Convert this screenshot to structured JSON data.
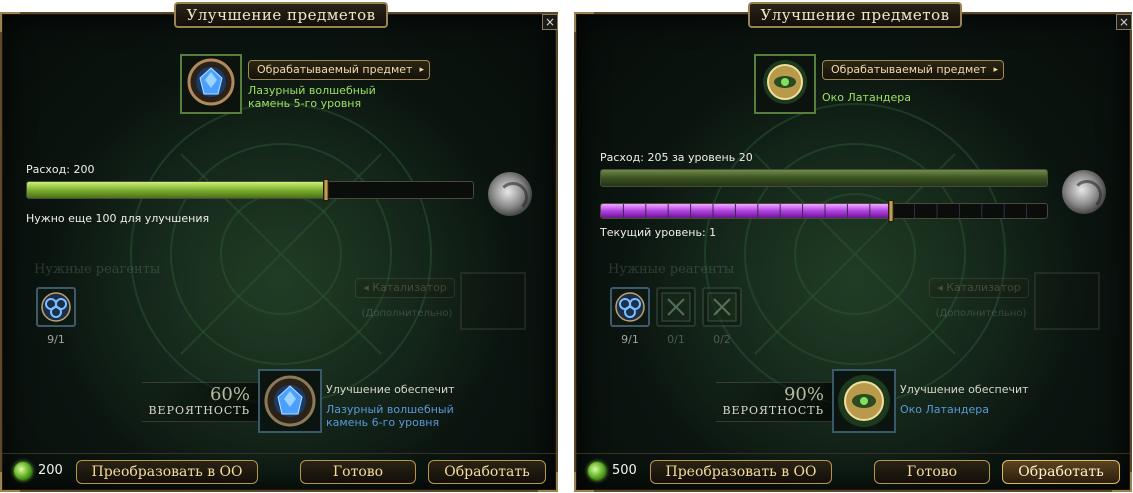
{
  "panels": [
    {
      "title": "Улучшение предметов",
      "close_label": "×",
      "processed_button_label": "Обрабатываемый предмет",
      "processed_arrow": "▸",
      "item_name": "Лазурный волшебный камень 5-го уровня",
      "cost_text": "Расход: 200",
      "status_text": "Нужно еще 100 для улучшения",
      "progress": 0.67,
      "reagents_title": "Нужные реагенты",
      "reagents": [
        {
          "count": "9/1",
          "icon": "blue-swirl-icon"
        }
      ],
      "catalyst_label": "◂ Катализатор",
      "catalyst_sub": "(Дополнительно)",
      "probability": "60%",
      "probability_label": "ВЕРОЯТНОСТЬ",
      "result_title": "Улучшение обеспечит",
      "result_name": "Лазурный волшебный камень 6-го уровня",
      "currency": "200",
      "buttons": {
        "convert": "Преобразовать в ОО",
        "done": "Готово",
        "process": "Обработать"
      }
    },
    {
      "title": "Улучшение предметов",
      "close_label": "×",
      "processed_button_label": "Обрабатываемый предмет",
      "processed_arrow": "▸",
      "item_name": "Око Латандера",
      "cost_text": "Расход: 205 за уровень 20",
      "status_text": "Текущий уровень: 1",
      "progress_top": 1.0,
      "progress": 0.65,
      "reagents_title": "Нужные реагенты",
      "reagents": [
        {
          "count": "9/1",
          "icon": "blue-swirl-icon"
        },
        {
          "count": "0/1",
          "icon": "green-rune-icon"
        },
        {
          "count": "0/2",
          "icon": "green-rune-icon"
        }
      ],
      "catalyst_label": "◂ Катализатор",
      "catalyst_sub": "(Дополнительно)",
      "probability": "90%",
      "probability_label": "ВЕРОЯТНОСТЬ",
      "result_title": "Улучшение обеспечит",
      "result_name": "Око Латандера",
      "currency": "500",
      "buttons": {
        "convert": "Преобразовать в ОО",
        "done": "Готово",
        "process": "Обработать"
      }
    }
  ]
}
